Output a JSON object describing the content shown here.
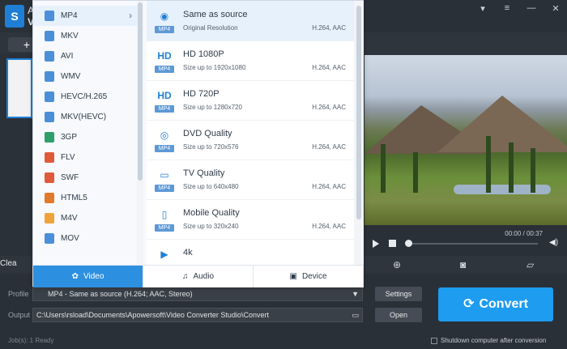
{
  "app": {
    "title_line1": "A",
    "title_line2": "V",
    "logo": "S"
  },
  "window_controls": [
    "shirt-icon",
    "settings-icon",
    "minimize-icon",
    "close-icon"
  ],
  "toolbar": {
    "add_label": "+"
  },
  "action_row": {
    "clean_label": "Clea"
  },
  "player": {
    "time": "00:00 / 00:37"
  },
  "formats_left": [
    {
      "name": "MP4",
      "color": "#4b8fd8",
      "selected": true
    },
    {
      "name": "MKV",
      "color": "#4b8fd8"
    },
    {
      "name": "AVI",
      "color": "#4b8fd8"
    },
    {
      "name": "WMV",
      "color": "#4b8fd8"
    },
    {
      "name": "HEVC/H.265",
      "color": "#4b8fd8"
    },
    {
      "name": "MKV(HEVC)",
      "color": "#4b8fd8"
    },
    {
      "name": "3GP",
      "color": "#2e9f6a"
    },
    {
      "name": "FLV",
      "color": "#e05a3a"
    },
    {
      "name": "SWF",
      "color": "#e05a3a"
    },
    {
      "name": "HTML5",
      "color": "#e07a2a"
    },
    {
      "name": "M4V",
      "color": "#f0a33a"
    },
    {
      "name": "MOV",
      "color": "#4b8fd8"
    }
  ],
  "presets": [
    {
      "thumb": "◉",
      "tag": "MP4",
      "title": "Same as source",
      "sub": "Original Resolution",
      "codec": "H.264, AAC",
      "selected": true
    },
    {
      "thumb": "HD",
      "tag": "MP4",
      "title": "HD 1080P",
      "sub": "Size up to 1920x1080",
      "codec": "H.264, AAC"
    },
    {
      "thumb": "HD",
      "tag": "MP4",
      "title": "HD 720P",
      "sub": "Size up to 1280x720",
      "codec": "H.264, AAC"
    },
    {
      "thumb": "◎",
      "tag": "MP4",
      "title": "DVD Quality",
      "sub": "Size up to 720x576",
      "codec": "H.264, AAC"
    },
    {
      "thumb": "▭",
      "tag": "MP4",
      "title": "TV Quality",
      "sub": "Size up to 640x480",
      "codec": "H.264, AAC"
    },
    {
      "thumb": "▯",
      "tag": "MP4",
      "title": "Mobile Quality",
      "sub": "Size up to 320x240",
      "codec": "H.264, AAC"
    },
    {
      "thumb": "▶",
      "tag": "",
      "title": "4k",
      "sub": "",
      "codec": ""
    }
  ],
  "tabs": [
    {
      "label": "Video",
      "icon": "film-icon",
      "active": true
    },
    {
      "label": "Audio",
      "icon": "headphones-icon"
    },
    {
      "label": "Device",
      "icon": "device-icon"
    }
  ],
  "bottom": {
    "profile_label": "Profile",
    "profile_value": "MP4 - Same as source (H.264; AAC, Stereo)",
    "output_label": "Output",
    "output_value": "C:\\Users\\rsload\\Documents\\Apowersoft\\Video Converter Studio\\Convert",
    "settings_label": "Settings",
    "open_label": "Open",
    "convert_label": "Convert",
    "status": "Job(s): 1   Ready",
    "shutdown_label": "Shutdown computer after conversion"
  }
}
